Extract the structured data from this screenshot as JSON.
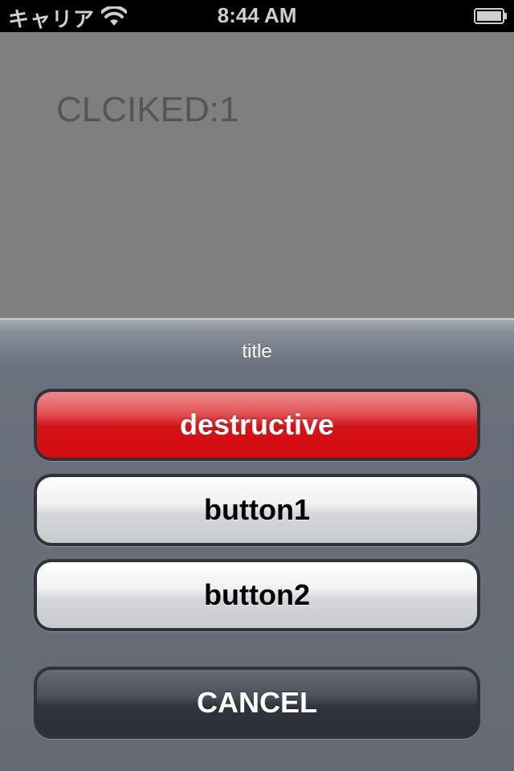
{
  "status_bar": {
    "carrier": "キャリア",
    "time": "8:44 AM",
    "wifi_icon": "wifi-icon",
    "battery_icon": "battery-icon"
  },
  "content": {
    "label": "CLCIKED:1",
    "background": "#7f7f7f"
  },
  "action_sheet": {
    "title": "title",
    "buttons": [
      {
        "label": "destructive",
        "style": "destructive",
        "color": "#d60a0a"
      },
      {
        "label": "button1",
        "style": "default"
      },
      {
        "label": "button2",
        "style": "default"
      }
    ],
    "cancel": {
      "label": "CANCEL",
      "color": "#2a2e37"
    }
  }
}
